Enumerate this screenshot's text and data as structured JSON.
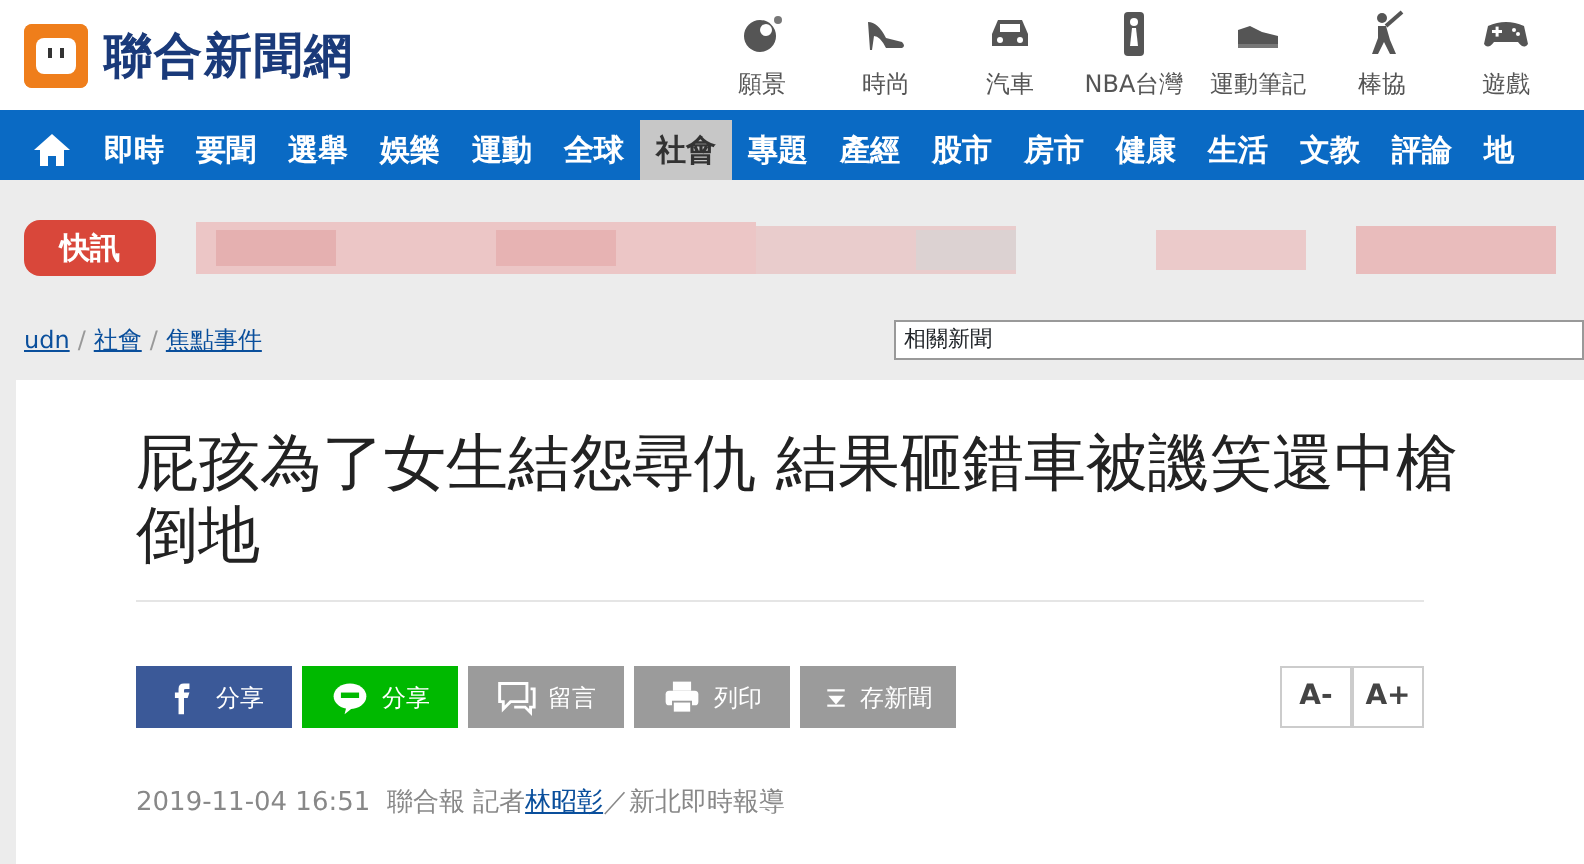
{
  "logo": {
    "title": "聯合新聞網"
  },
  "channels": [
    {
      "label": "願景",
      "kind": "vision"
    },
    {
      "label": "時尚",
      "kind": "heel"
    },
    {
      "label": "汽車",
      "kind": "car"
    },
    {
      "label": "NBA台灣",
      "kind": "player"
    },
    {
      "label": "運動筆記",
      "kind": "shoe"
    },
    {
      "label": "棒協",
      "kind": "batter"
    },
    {
      "label": "遊戲",
      "kind": "gamepad"
    }
  ],
  "nav": [
    {
      "label": "即時",
      "selected": false
    },
    {
      "label": "要聞",
      "selected": false
    },
    {
      "label": "選舉",
      "selected": false
    },
    {
      "label": "娛樂",
      "selected": false
    },
    {
      "label": "運動",
      "selected": false
    },
    {
      "label": "全球",
      "selected": false
    },
    {
      "label": "社會",
      "selected": true
    },
    {
      "label": "專題",
      "selected": false
    },
    {
      "label": "產經",
      "selected": false
    },
    {
      "label": "股市",
      "selected": false
    },
    {
      "label": "房市",
      "selected": false
    },
    {
      "label": "健康",
      "selected": false
    },
    {
      "label": "生活",
      "selected": false
    },
    {
      "label": "文教",
      "selected": false
    },
    {
      "label": "評論",
      "selected": false
    },
    {
      "label": "地",
      "selected": false
    }
  ],
  "flash": {
    "label": "快訊"
  },
  "breadcrumb": [
    {
      "label": "udn",
      "kind": "link"
    },
    {
      "label": "/",
      "kind": "separator"
    },
    {
      "label": "社會",
      "kind": "link"
    },
    {
      "label": "/",
      "kind": "separator"
    },
    {
      "label": "焦點事件",
      "kind": "link"
    }
  ],
  "related": {
    "value": "相關新聞"
  },
  "article": {
    "title": "屁孩為了女生結怨尋仇 結果砸錯車被譏笑還中槍倒地",
    "share": [
      {
        "label": "分享",
        "kind": "facebook"
      },
      {
        "label": "分享",
        "kind": "line"
      },
      {
        "label": "留言",
        "kind": "comment"
      },
      {
        "label": "列印",
        "kind": "print"
      },
      {
        "label": "存新聞",
        "kind": "save"
      }
    ],
    "font_size": [
      "A-",
      "A+"
    ],
    "date": "2019-11-04 16:51",
    "source": "聯合報",
    "reporter_prefix": "記者",
    "reporter": "林昭彰",
    "desk": "／新北即時報導"
  }
}
